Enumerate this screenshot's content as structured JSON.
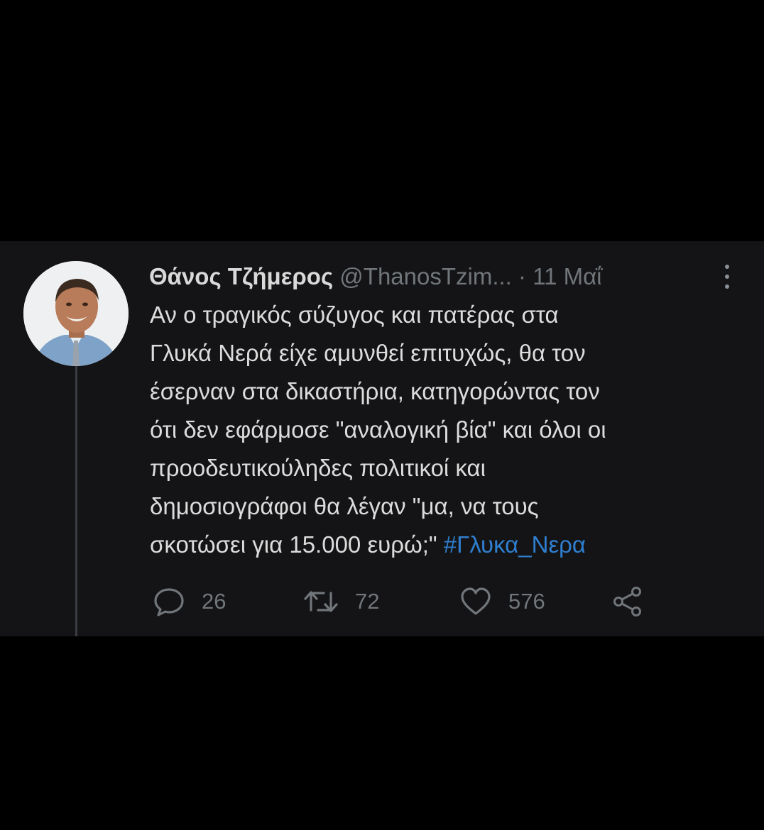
{
  "tweet": {
    "display_name": "Θάνος Τζήμερος",
    "handle": "@ThanosTzim...",
    "separator": "·",
    "date": "11 Μαΐ",
    "text_lines": [
      "Αν ο τραγικός σύζυγος και πατέρας στα",
      "Γλυκά Νερά είχε αμυνθεί επιτυχώς, θα τον",
      "έσερναν στα δικαστήρια, κατηγορώντας τον",
      "ότι δεν εφάρμοσε \"αναλογική βία\" και όλοι οι",
      "προοδευτικούληδες πολιτικοί και",
      "δημοσιογράφοι θα λέγαν \"μα, να τους",
      "σκοτώσει για 15.000 ευρώ;\" "
    ],
    "hashtag": "#Γλυκα_Νερα",
    "replies": "26",
    "retweets": "72",
    "likes": "576"
  },
  "icons": {
    "reply": "speech-bubble-icon",
    "retweet": "retweet-arrows-icon",
    "like": "heart-icon",
    "share": "share-nodes-icon",
    "menu": "vertical-ellipsis-icon"
  },
  "colors": {
    "background": "#000000",
    "card": "#141416",
    "text": "#dcdcdc",
    "muted": "#71767b",
    "hashtag": "#2f7fd0"
  }
}
